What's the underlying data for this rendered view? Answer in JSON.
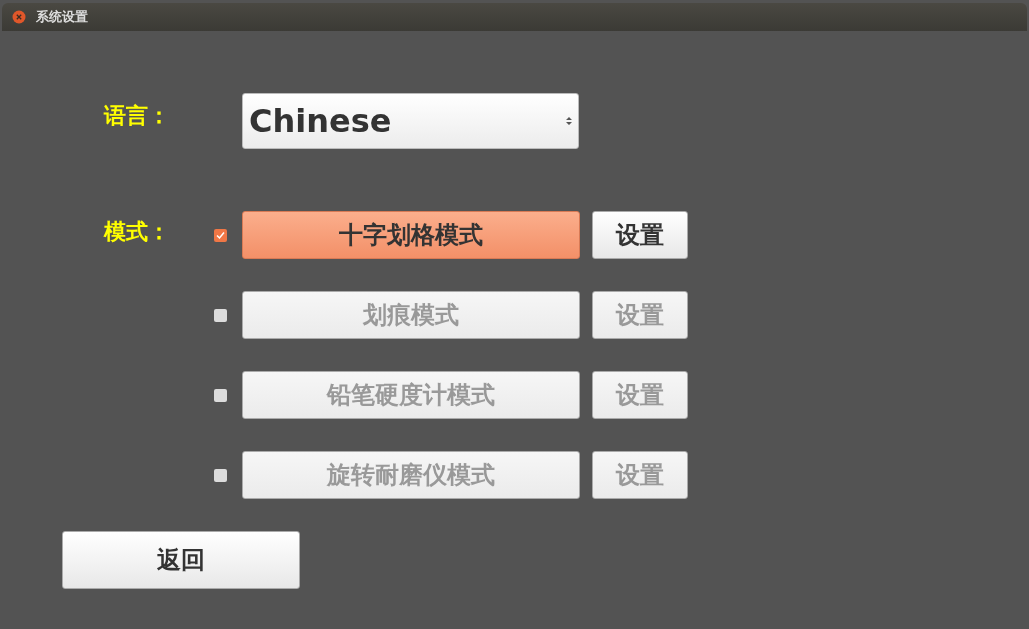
{
  "window": {
    "title": "系统设置"
  },
  "language": {
    "label": "语言：",
    "value": "Chinese"
  },
  "mode": {
    "label": "模式：",
    "items": [
      {
        "label": "十字划格模式",
        "checked": true,
        "disabled": false,
        "settings_label": "设置",
        "settings_disabled": false
      },
      {
        "label": "划痕模式",
        "checked": false,
        "disabled": true,
        "settings_label": "设置",
        "settings_disabled": true
      },
      {
        "label": "铅笔硬度计模式",
        "checked": false,
        "disabled": true,
        "settings_label": "设置",
        "settings_disabled": true
      },
      {
        "label": "旋转耐磨仪模式",
        "checked": false,
        "disabled": true,
        "settings_label": "设置",
        "settings_disabled": true
      }
    ]
  },
  "back_button": "返回"
}
